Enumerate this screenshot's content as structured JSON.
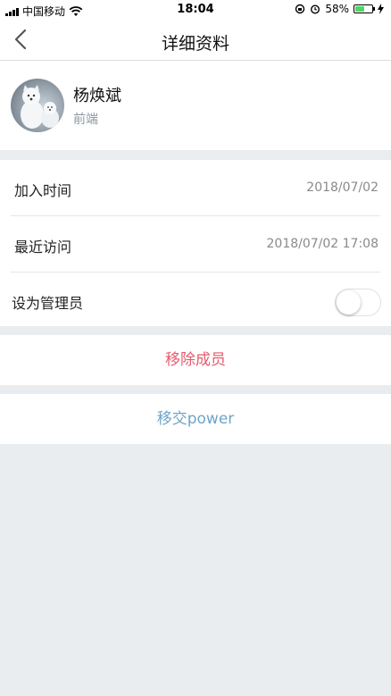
{
  "status_bar": {
    "carrier": "中国移动",
    "time": "18:04",
    "battery": "58%",
    "battery_level": 0.58
  },
  "nav": {
    "title": "详细资料",
    "back_icon": "chevron-left-icon"
  },
  "profile": {
    "name": "杨焕斌",
    "department": "前端"
  },
  "info": {
    "join_label": "加入时间",
    "join_value": "2018/07/02",
    "visit_label": "最近访问",
    "visit_value": "2018/07/02 17:08",
    "admin_label": "设为管理员",
    "admin_enabled": false
  },
  "actions": {
    "remove": "移除成员",
    "transfer": "移交power"
  },
  "colors": {
    "remove_text": "#e65b6e",
    "transfer_text": "#6fa4c7",
    "background": "#e9edf0",
    "battery_green": "#4cd964"
  }
}
